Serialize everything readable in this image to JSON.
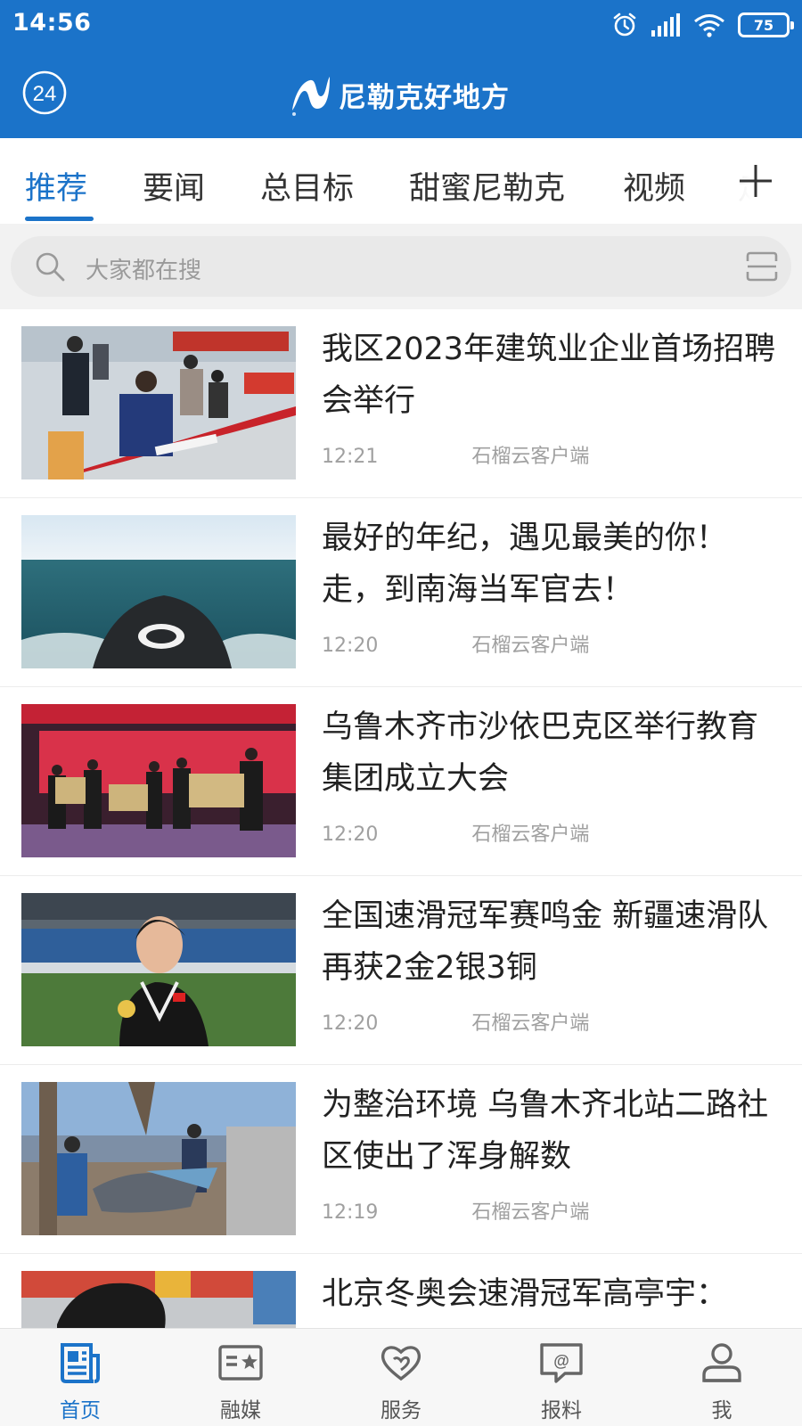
{
  "status": {
    "time": "14:56",
    "battery": "75"
  },
  "header": {
    "badge": "24",
    "brand": "尼勒克好地方"
  },
  "tabs": [
    {
      "label": "推荐"
    },
    {
      "label": "要闻"
    },
    {
      "label": "总目标"
    },
    {
      "label": "甜蜜尼勒克"
    },
    {
      "label": "视频"
    },
    {
      "label": "走进"
    }
  ],
  "search": {
    "placeholder": "大家都在搜"
  },
  "news": [
    {
      "title": "我区2023年建筑业企业首场招聘会举行",
      "time": "12:21",
      "source": "石榴云客户端"
    },
    {
      "title": "最好的年纪，遇见最美的你！走，到南海当军官去！",
      "time": "12:20",
      "source": "石榴云客户端"
    },
    {
      "title": "乌鲁木齐市沙依巴克区举行教育集团成立大会",
      "time": "12:20",
      "source": "石榴云客户端"
    },
    {
      "title": "全国速滑冠军赛鸣金 新疆速滑队再获2金2银3铜",
      "time": "12:20",
      "source": "石榴云客户端"
    },
    {
      "title": "为整治环境 乌鲁木齐北站二路社区使出了浑身解数",
      "time": "12:19",
      "source": "石榴云客户端"
    },
    {
      "title": "北京冬奥会速滑冠军高亭宇：",
      "time": "",
      "source": ""
    }
  ],
  "bottom_nav": [
    {
      "label": "首页",
      "icon": "news-icon"
    },
    {
      "label": "融媒",
      "icon": "media-icon"
    },
    {
      "label": "服务",
      "icon": "heart-icon"
    },
    {
      "label": "报料",
      "icon": "report-icon"
    },
    {
      "label": "我",
      "icon": "person-icon"
    }
  ],
  "colors": {
    "brand": "#1b73c9",
    "text": "#222222",
    "muted": "#a0a0a0"
  }
}
